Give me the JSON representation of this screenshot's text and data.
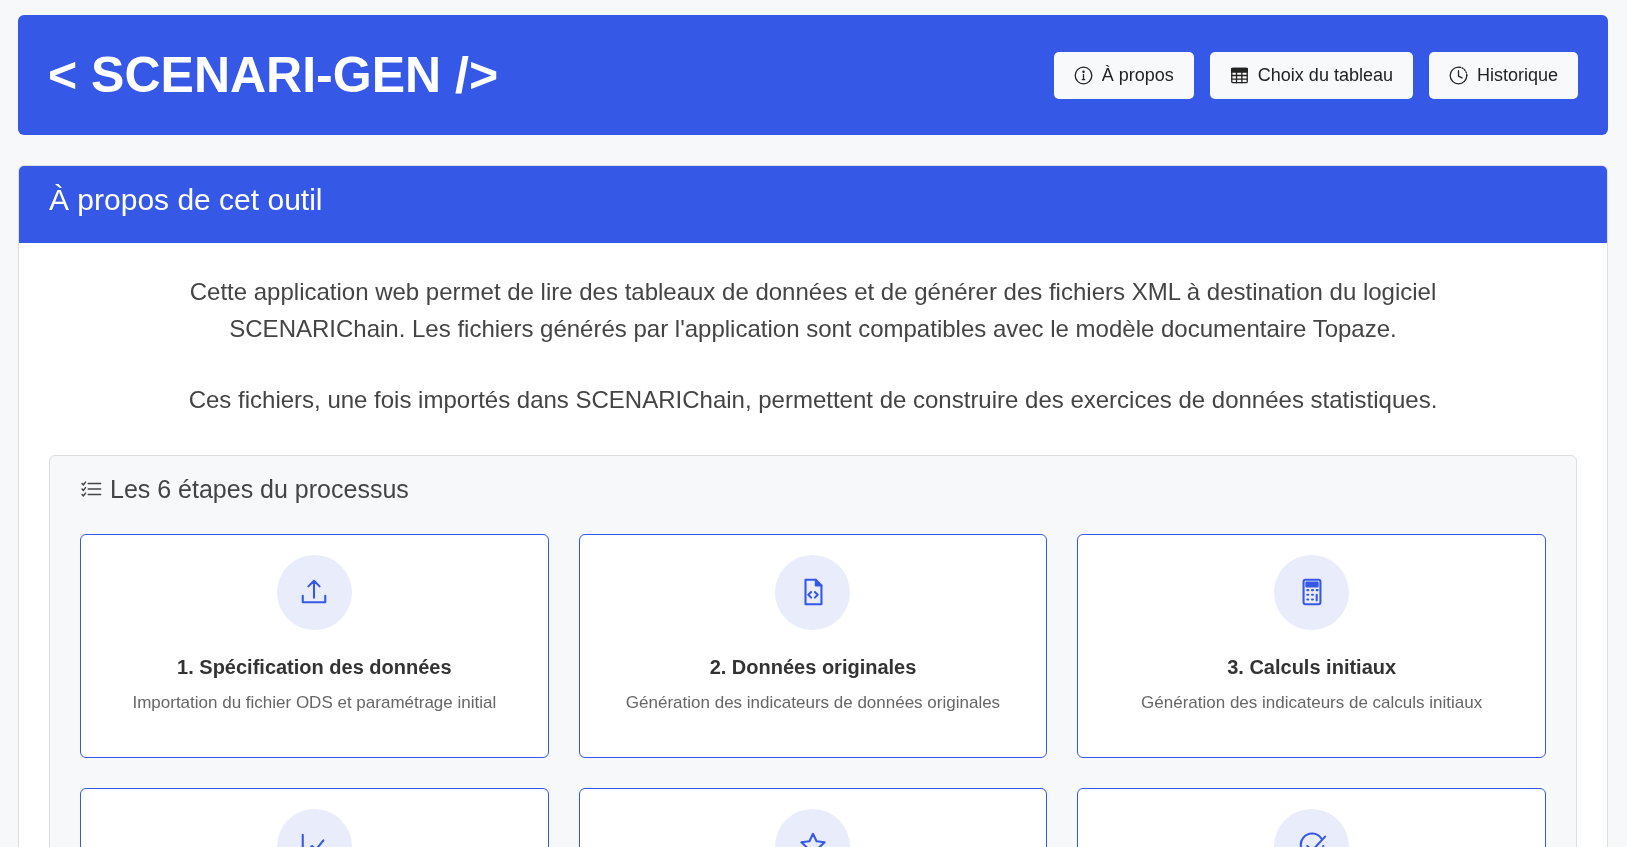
{
  "header": {
    "logo": "< SCENARI-GEN />",
    "buttons": [
      {
        "label": "À propos"
      },
      {
        "label": "Choix du tableau"
      },
      {
        "label": "Historique"
      }
    ]
  },
  "about": {
    "title": "À propos de cet outil",
    "paragraphs": [
      "Cette application web permet de lire des tableaux de données et de générer des fichiers XML à destination du logiciel SCENARIChain. Les fichiers générés par l'application sont compatibles avec le modèle documentaire Topaze.",
      "Ces fichiers, une fois importés dans SCENARIChain, permettent de construire des exercices de données statistiques."
    ],
    "process": {
      "title": "Les 6 étapes du processus",
      "steps": [
        {
          "title": "1. Spécification des données",
          "description": "Importation du fichier ODS et paramétrage initial"
        },
        {
          "title": "2. Données originales",
          "description": "Génération des indicateurs de données originales"
        },
        {
          "title": "3. Calculs initiaux",
          "description": "Génération des indicateurs de calculs initiaux"
        }
      ]
    }
  }
}
